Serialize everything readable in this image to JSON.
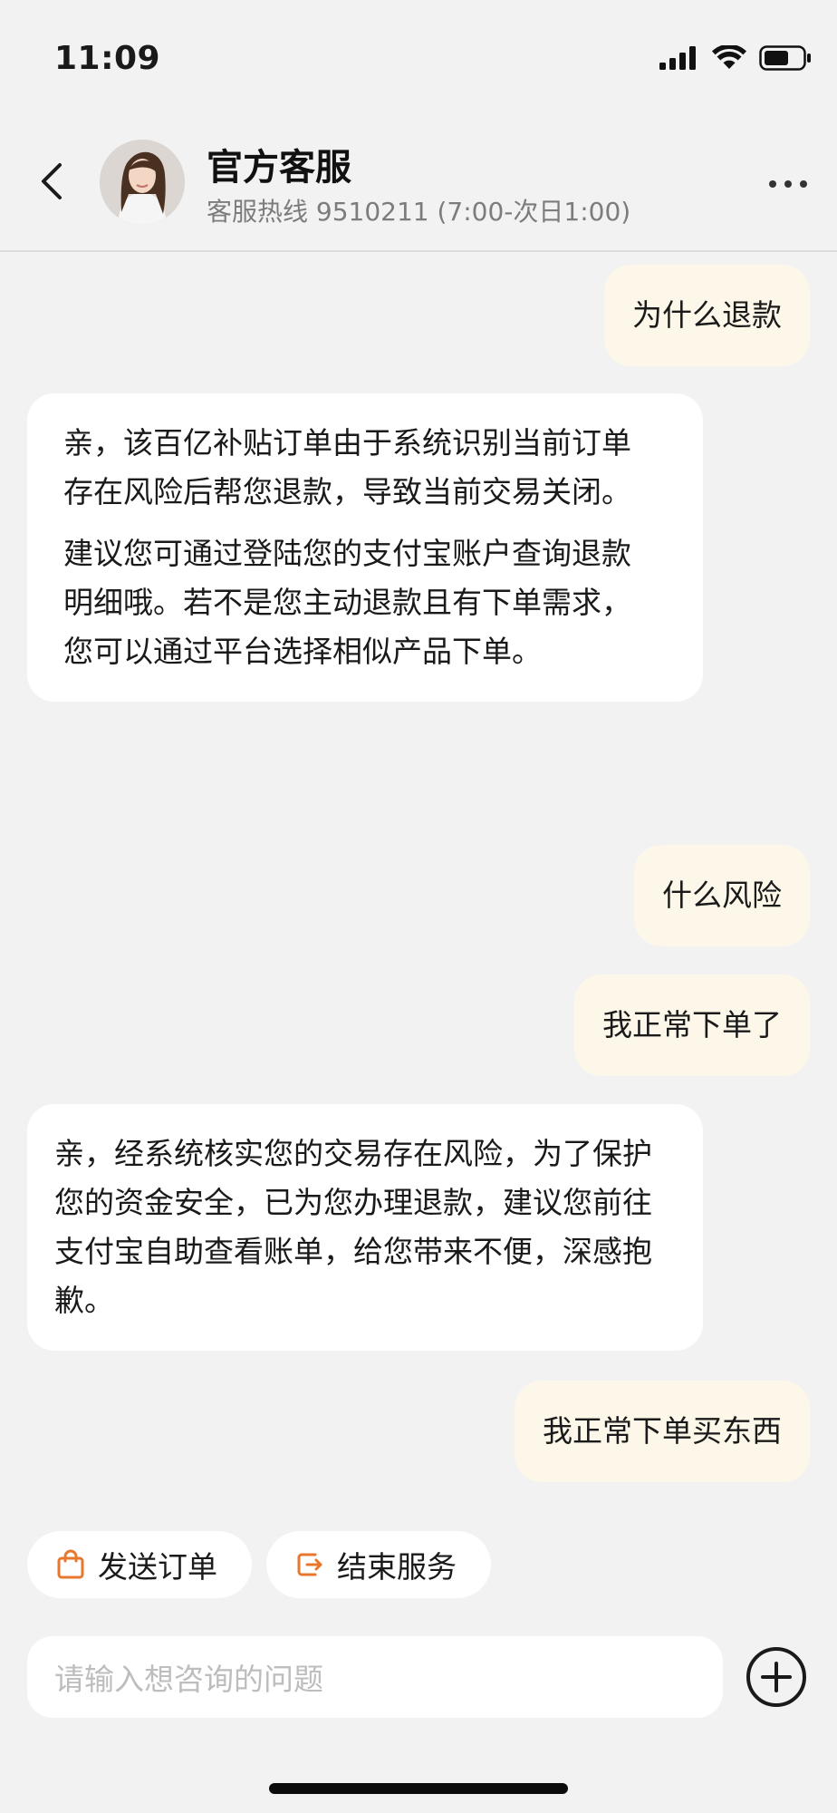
{
  "status_bar": {
    "time": "11:09"
  },
  "header": {
    "title": "官方客服",
    "subtitle": "客服热线 9510211 (7:00-次日1:00)"
  },
  "messages": [
    {
      "sender": "user",
      "text": "为什么退款"
    },
    {
      "sender": "agent",
      "paragraphs": [
        "亲，该百亿补贴订单由于系统识别当前订单存在风险后帮您退款，导致当前交易关闭。",
        "建议您可通过登陆您的支付宝账户查询退款明细哦。若不是您主动退款且有下单需求，您可以通过平台选择相似产品下单。"
      ]
    },
    {
      "sender": "user",
      "text": "什么风险"
    },
    {
      "sender": "user",
      "text": "我正常下单了"
    },
    {
      "sender": "agent",
      "paragraphs": [
        "亲，经系统核实您的交易存在风险，为了保护您的资金安全，已为您办理退款，建议您前往支付宝自助查看账单，给您带来不便，深感抱歉。"
      ]
    },
    {
      "sender": "user",
      "text": "我正常下单买东西"
    }
  ],
  "quick_actions": {
    "send_order": "发送订单",
    "end_service": "结束服务"
  },
  "input": {
    "placeholder": "请输入想咨询的问题"
  },
  "colors": {
    "accent": "#e8772e",
    "user_bubble": "#fdf7e9",
    "agent_bubble": "#ffffff",
    "background": "#f2f2f2"
  },
  "icons": {
    "back": "chevron-left-icon",
    "more": "more-dots-icon",
    "send_order": "shopping-bag-icon",
    "end_service": "exit-icon",
    "plus": "plus-circle-icon"
  }
}
